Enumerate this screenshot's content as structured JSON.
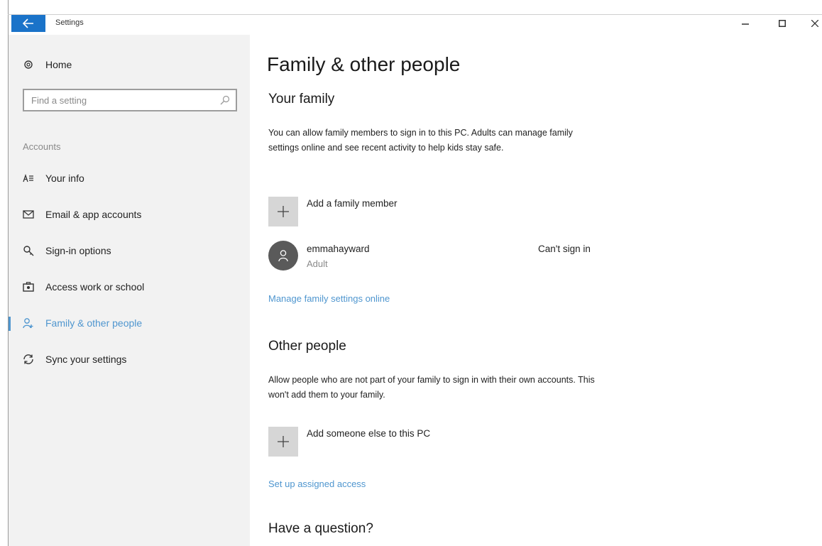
{
  "window": {
    "title": "Settings"
  },
  "sidebar": {
    "home_label": "Home",
    "search": {
      "placeholder": "Find a setting",
      "value": ""
    },
    "section_label": "Accounts",
    "items": [
      {
        "label": "Your info",
        "icon": "person-card-icon"
      },
      {
        "label": "Email & app accounts",
        "icon": "mail-icon"
      },
      {
        "label": "Sign-in options",
        "icon": "key-icon"
      },
      {
        "label": "Access work or school",
        "icon": "briefcase-icon"
      },
      {
        "label": "Family & other people",
        "icon": "person-add-icon",
        "active": true
      },
      {
        "label": "Sync your settings",
        "icon": "sync-icon"
      }
    ]
  },
  "main": {
    "title": "Family & other people",
    "family": {
      "heading": "Your family",
      "description": "You can allow family members to sign in to this PC. Adults can manage family settings online and see recent activity to help kids stay safe.",
      "add_label": "Add a family member",
      "member": {
        "name": "emmahayward",
        "role": "Adult",
        "status": "Can't sign in"
      },
      "manage_link": "Manage family settings online"
    },
    "other": {
      "heading": "Other people",
      "description": "Allow people who are not part of your family to sign in with their own accounts. This won't add them to your family.",
      "add_label": "Add someone else to this PC",
      "assigned_link": "Set up assigned access"
    },
    "question_heading": "Have a question?"
  },
  "colors": {
    "accent": "#4f96cf",
    "back_button": "#1a73c9",
    "sidebar_bg": "#f2f2f2"
  }
}
